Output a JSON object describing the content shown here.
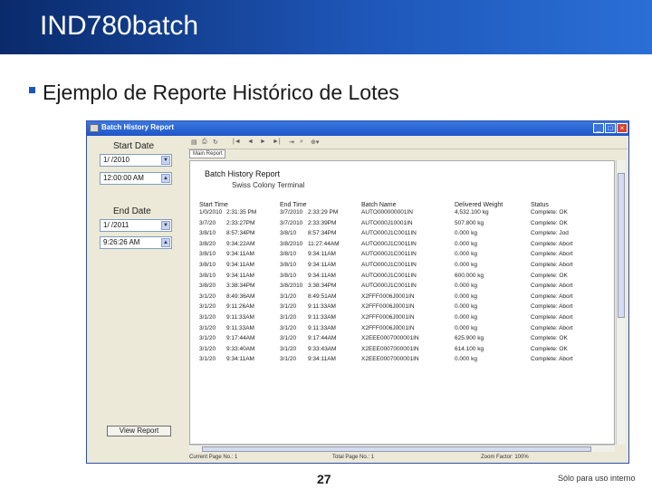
{
  "slide": {
    "title": "IND780batch",
    "heading": "Ejemplo de Reporte Histórico de Lotes",
    "page_number": "27",
    "footer_note": "Sólo para uso interno"
  },
  "window": {
    "title": "Batch History Report",
    "start_date_label": "Start Date",
    "start_date_value": "1/ /2010",
    "start_time_value": "12:00:00 AM",
    "end_date_label": "End Date",
    "end_date_value": "1/ /2011",
    "end_time_value": "9:26:26 AM",
    "view_report_label": "View Report"
  },
  "viewer": {
    "tab_label": "Main Report",
    "report_title": "Batch History Report",
    "report_subtitle": "Swiss Colony   Terminal",
    "columns": [
      "Start Time",
      "End Time",
      "Batch Name",
      "Delivered Weight",
      "Status"
    ],
    "rows": [
      [
        "1/0/2010",
        "2:31:35 PM",
        "3/7/2010",
        "2:33:29 PM",
        "AUTO000000001IN",
        "4,532.100 kg",
        "Complete: OK"
      ],
      [
        "3/7/20",
        "2:33:27PM",
        "3/7/2010",
        "2:33:39PM",
        "AUTO000J10001IN",
        "507.800 kg",
        "Complete: OK"
      ],
      [
        "3/8/10",
        "8:57:34PM",
        "3/8/10",
        "8:57:34PM",
        "AUTO000J1C0011IN",
        "0.000 kg",
        "Complete: Jod"
      ],
      [
        "3/8/20",
        "9:34:22AM",
        "3/8/2010",
        "11:27:44AM",
        "AUTO000J1C0011IN",
        "0.000 kg",
        "Complete: Abort"
      ],
      [
        "3/8/10",
        "9:34:11AM",
        "3/8/10",
        "9:34:11AM",
        "AUTO000J1C0011IN",
        "0.000 kg",
        "Complete: Abort"
      ],
      [
        "3/8/10",
        "9:34:11AM",
        "3/8/10",
        "9:34:11AM",
        "AUTO000J1C0011IN",
        "0.000 kg",
        "Complete: Abort"
      ],
      [
        "3/8/10",
        "9:34:11AM",
        "3/8/10",
        "9:34:11AM",
        "AUTO000J1C0011IN",
        "600.000 kg",
        "Complete: OK"
      ],
      [
        "3/8/20",
        "3:38:34PM",
        "3/8/2010",
        "3:38:34PM",
        "AUTO000J1C0011IN",
        "0.000 kg",
        "Complete: Abort"
      ],
      [
        "3/1/20",
        "8:49:36AM",
        "3/1/20",
        "8:49:51AM",
        "X2FFF0006J0001IN",
        "0.000 kg",
        "Complete: Abort"
      ],
      [
        "3/1/20",
        "9:11:26AM",
        "3/1/20",
        "9:11:33AM",
        "X2FFF0006J0001IN",
        "0.000 kg",
        "Complete: Abort"
      ],
      [
        "3/1/20",
        "9:11:33AM",
        "3/1/20",
        "9:11:33AM",
        "X2FFF0006J0001IN",
        "0.000 kg",
        "Complete: Abort"
      ],
      [
        "3/1/20",
        "9:11:33AM",
        "3/1/20",
        "9:11:33AM",
        "X2FFF0006J0001IN",
        "0.000 kg",
        "Complete: Abort"
      ],
      [
        "3/1/20",
        "9:17:44AM",
        "3/1/20",
        "9:17:44AM",
        "X2EEE0007000001IN",
        "625.900 kg",
        "Complete: OK"
      ],
      [
        "3/1/20",
        "9:33:40AM",
        "3/1/20",
        "9:33:43AM",
        "X2EEE0007000001IN",
        "614.100 kg",
        "Complete: OK"
      ],
      [
        "3/1/20",
        "9:34:11AM",
        "3/1/20",
        "9:34:11AM",
        "X2EEE0007000001IN",
        "0.000 kg",
        "Complete: Abort"
      ]
    ],
    "status_left": "Current Page No.: 1",
    "status_mid": "Total Page No.: 1",
    "status_right": "Zoom Factor: 100%"
  }
}
